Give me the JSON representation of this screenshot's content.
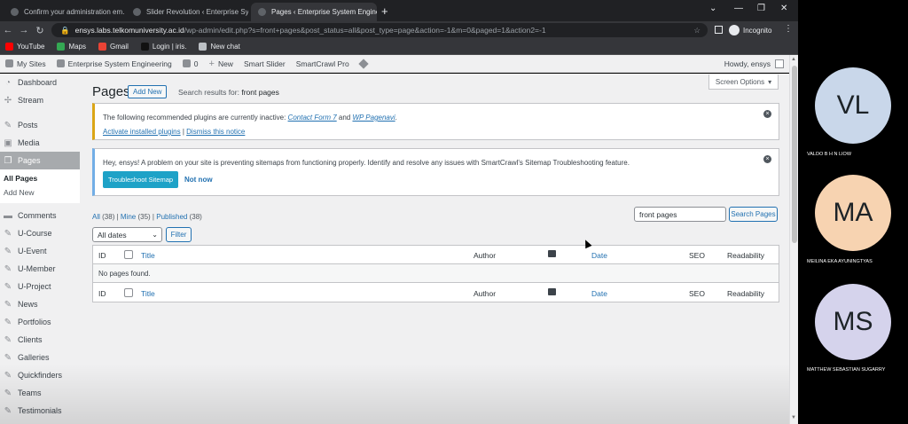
{
  "browser": {
    "tabs": [
      {
        "title": "Confirm your administration em…",
        "active": false
      },
      {
        "title": "Slider Revolution ‹ Enterprise Sys…",
        "active": false
      },
      {
        "title": "Pages ‹ Enterprise System Engine…",
        "active": true
      }
    ],
    "url_host": "ensys.labs.telkomuniversity.ac.id",
    "url_path": "/wp-admin/edit.php?s=front+pages&post_status=all&post_type=page&action=-1&m=0&paged=1&action2=-1",
    "incognito_label": "Incognito",
    "bookmarks": [
      {
        "label": "YouTube",
        "icon": "youtube-icon",
        "color": "#ff0000"
      },
      {
        "label": "Maps",
        "icon": "maps-icon",
        "color": "#34a853"
      },
      {
        "label": "Gmail",
        "icon": "gmail-icon",
        "color": "#ea4335"
      },
      {
        "label": "Login | iris.",
        "icon": "login-icon",
        "color": "#202124"
      },
      {
        "label": "New chat",
        "icon": "chat-icon",
        "color": "#bdc1c6"
      }
    ]
  },
  "adminbar": {
    "my_sites": "My Sites",
    "site_name": "Enterprise System Engineering",
    "comments_count": "0",
    "new_label": "New",
    "smart_slider": "Smart Slider",
    "smartcrawl": "SmartCrawl Pro",
    "howdy": "Howdy, ensys"
  },
  "sidebar": {
    "items_top": [
      {
        "label": "Dashboard",
        "icon": "dashboard-icon"
      },
      {
        "label": "Stream",
        "icon": "stream-icon"
      }
    ],
    "items_mid": [
      {
        "label": "Posts",
        "icon": "pin-icon"
      },
      {
        "label": "Media",
        "icon": "media-icon"
      },
      {
        "label": "Pages",
        "icon": "pages-icon"
      }
    ],
    "submenu": [
      "All Pages",
      "Add New"
    ],
    "items_bottom": [
      {
        "label": "Comments",
        "icon": "comment-icon"
      },
      {
        "label": "U-Course",
        "icon": "pin-icon"
      },
      {
        "label": "U-Event",
        "icon": "pin-icon"
      },
      {
        "label": "U-Member",
        "icon": "pin-icon"
      },
      {
        "label": "U-Project",
        "icon": "pin-icon"
      },
      {
        "label": "News",
        "icon": "pin-icon"
      },
      {
        "label": "Portfolios",
        "icon": "pin-icon"
      },
      {
        "label": "Clients",
        "icon": "pin-icon"
      },
      {
        "label": "Galleries",
        "icon": "pin-icon"
      },
      {
        "label": "Quickfinders",
        "icon": "pin-icon"
      },
      {
        "label": "Teams",
        "icon": "pin-icon"
      },
      {
        "label": "Testimonials",
        "icon": "pin-icon"
      }
    ]
  },
  "main": {
    "screen_options": "Screen Options",
    "title": "Pages",
    "add_new": "Add New",
    "search_results_prefix": "Search results for: ",
    "search_term": "front pages",
    "notice_plugins": {
      "text_before": "The following recommended plugins are currently inactive: ",
      "plugin1": "Contact Form 7",
      "and": " and ",
      "plugin2": "WP Pagenavi",
      "period": ".",
      "activate": "Activate installed plugins",
      "separator": " | ",
      "dismiss": "Dismiss this notice"
    },
    "notice_sitemap": {
      "text": "Hey, ensys! A problem on your site is preventing sitemaps from functioning properly. Identify and resolve any issues with SmartCrawl's Sitemap Troubleshooting feature.",
      "primary": "Troubleshoot Sitemap",
      "secondary": "Not now"
    },
    "views": {
      "all": "All",
      "all_count": "(38)",
      "mine": "Mine",
      "mine_count": "(35)",
      "published": "Published",
      "published_count": "(38)",
      "sep": " | "
    },
    "search_value": "front pages",
    "search_button": "Search Pages",
    "date_filter": "All dates",
    "filter_button": "Filter",
    "columns": {
      "id": "ID",
      "title": "Title",
      "author": "Author",
      "date": "Date",
      "seo": "SEO",
      "readability": "Readability"
    },
    "empty_message": "No pages found."
  },
  "meeting": {
    "participants": [
      {
        "initials": "VL",
        "name": "VALDO B H N LIOW",
        "color": "#c9d7ea"
      },
      {
        "initials": "MA",
        "name": "MEILINA EKA AYUNINGTYAS",
        "color": "#f7d3b1"
      },
      {
        "initials": "MS",
        "name": "MATTHEW SEBASTIAN SUGARRY",
        "color": "#d5d3ec"
      }
    ]
  }
}
